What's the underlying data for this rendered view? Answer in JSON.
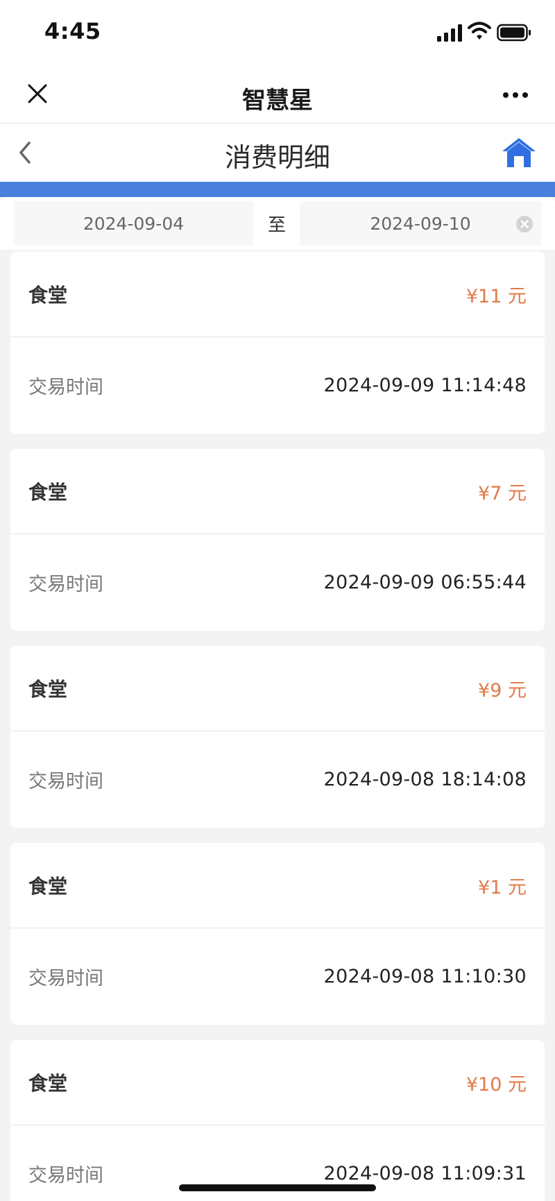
{
  "status_bar": {
    "time": "4:45"
  },
  "app_bar": {
    "title": "智慧星"
  },
  "page_header": {
    "title": "消费明细"
  },
  "date_filter": {
    "start": "2024-09-04",
    "separator": "至",
    "end": "2024-09-10"
  },
  "records": [
    {
      "merchant": "食堂",
      "amount": "¥11 元",
      "time_label": "交易时间",
      "time": "2024-09-09 11:14:48"
    },
    {
      "merchant": "食堂",
      "amount": "¥7 元",
      "time_label": "交易时间",
      "time": "2024-09-09 06:55:44"
    },
    {
      "merchant": "食堂",
      "amount": "¥9 元",
      "time_label": "交易时间",
      "time": "2024-09-08 18:14:08"
    },
    {
      "merchant": "食堂",
      "amount": "¥1 元",
      "time_label": "交易时间",
      "time": "2024-09-08 11:10:30"
    },
    {
      "merchant": "食堂",
      "amount": "¥10 元",
      "time_label": "交易时间",
      "time": "2024-09-08 11:09:31"
    }
  ],
  "colors": {
    "accent_blue": "#4a7fdc",
    "amount_orange": "#e07b4a",
    "home_icon_blue": "#2f6fe0"
  },
  "icons": {
    "close": "close-icon",
    "more": "more-icon",
    "back": "back-chevron-icon",
    "home": "home-icon",
    "clear": "clear-icon"
  }
}
